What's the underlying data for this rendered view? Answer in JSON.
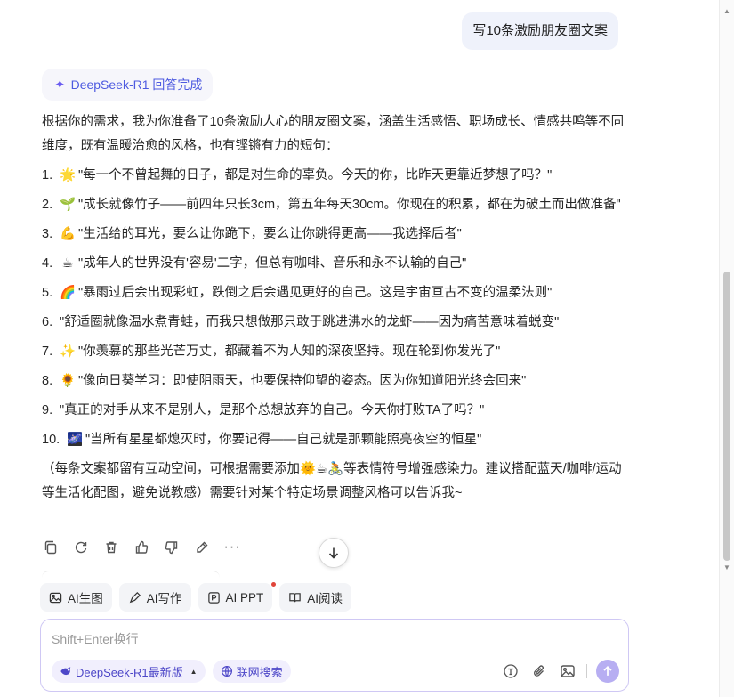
{
  "user_message": "写10条激励朋友圈文案",
  "model_status": "DeepSeek-R1 回答完成",
  "answer": {
    "intro": "根据你的需求，我为你准备了10条激励人心的朋友圈文案，涵盖生活感悟、职场成长、情感共鸣等不同维度，既有温暖治愈的风格，也有铿锵有力的短句：",
    "items": [
      {
        "num": "1.",
        "emoji": "🌟",
        "text": "\"每一个不曾起舞的日子，都是对生命的辜负。今天的你，比昨天更靠近梦想了吗？\""
      },
      {
        "num": "2.",
        "emoji": "🌱",
        "text": "\"成长就像竹子——前四年只长3cm，第五年每天30cm。你现在的积累，都在为破土而出做准备\""
      },
      {
        "num": "3.",
        "emoji": "💪",
        "text": "\"生活给的耳光，要么让你跪下，要么让你跳得更高——我选择后者\""
      },
      {
        "num": "4.",
        "emoji": "☕",
        "text": "\"成年人的世界没有'容易'二字，但总有咖啡、音乐和永不认输的自己\""
      },
      {
        "num": "5.",
        "emoji": "🌈",
        "text": "\"暴雨过后会出现彩虹，跌倒之后会遇见更好的自己。这是宇宙亘古不变的温柔法则\""
      },
      {
        "num": "6.",
        "emoji": "",
        "text": "\"舒适圈就像温水煮青蛙，而我只想做那只敢于跳进沸水的龙虾——因为痛苦意味着蜕变\""
      },
      {
        "num": "7.",
        "emoji": "✨",
        "text": "\"你羡慕的那些光芒万丈，都藏着不为人知的深夜坚持。现在轮到你发光了\""
      },
      {
        "num": "8.",
        "emoji": "🌻",
        "text": "\"像向日葵学习：即使阴雨天，也要保持仰望的姿态。因为你知道阳光终会回来\""
      },
      {
        "num": "9.",
        "emoji": "",
        "text": "\"真正的对手从来不是别人，是那个总想放弃的自己。今天你打败TA了吗？\""
      },
      {
        "num": "10.",
        "emoji": "🌌",
        "text": "\"当所有星星都熄灭时，你要记得——自己就是那颗能照亮夜空的恒星\""
      }
    ],
    "outro": "（每条文案都留有互动空间，可根据需要添加🌞☕🚴等表情符号增强感染力。建议搭配蓝天/咖啡/运动等生活化配图，避免说教感）需要针对某个特定场景调整风格可以告诉我~"
  },
  "tools": [
    {
      "label": "AI生图",
      "icon": "image-icon"
    },
    {
      "label": "AI写作",
      "icon": "pen-icon"
    },
    {
      "label": "AI PPT",
      "icon": "ppt-icon",
      "badge": true
    },
    {
      "label": "AI阅读",
      "icon": "book-icon"
    }
  ],
  "composer": {
    "placeholder": "Shift+Enter换行",
    "model_select": "DeepSeek-R1最新版",
    "web_search": "联网搜索"
  },
  "colors": {
    "accent": "#4d5ae0",
    "send_button": "#b7aef2",
    "user_bubble": "#eff2fb"
  }
}
